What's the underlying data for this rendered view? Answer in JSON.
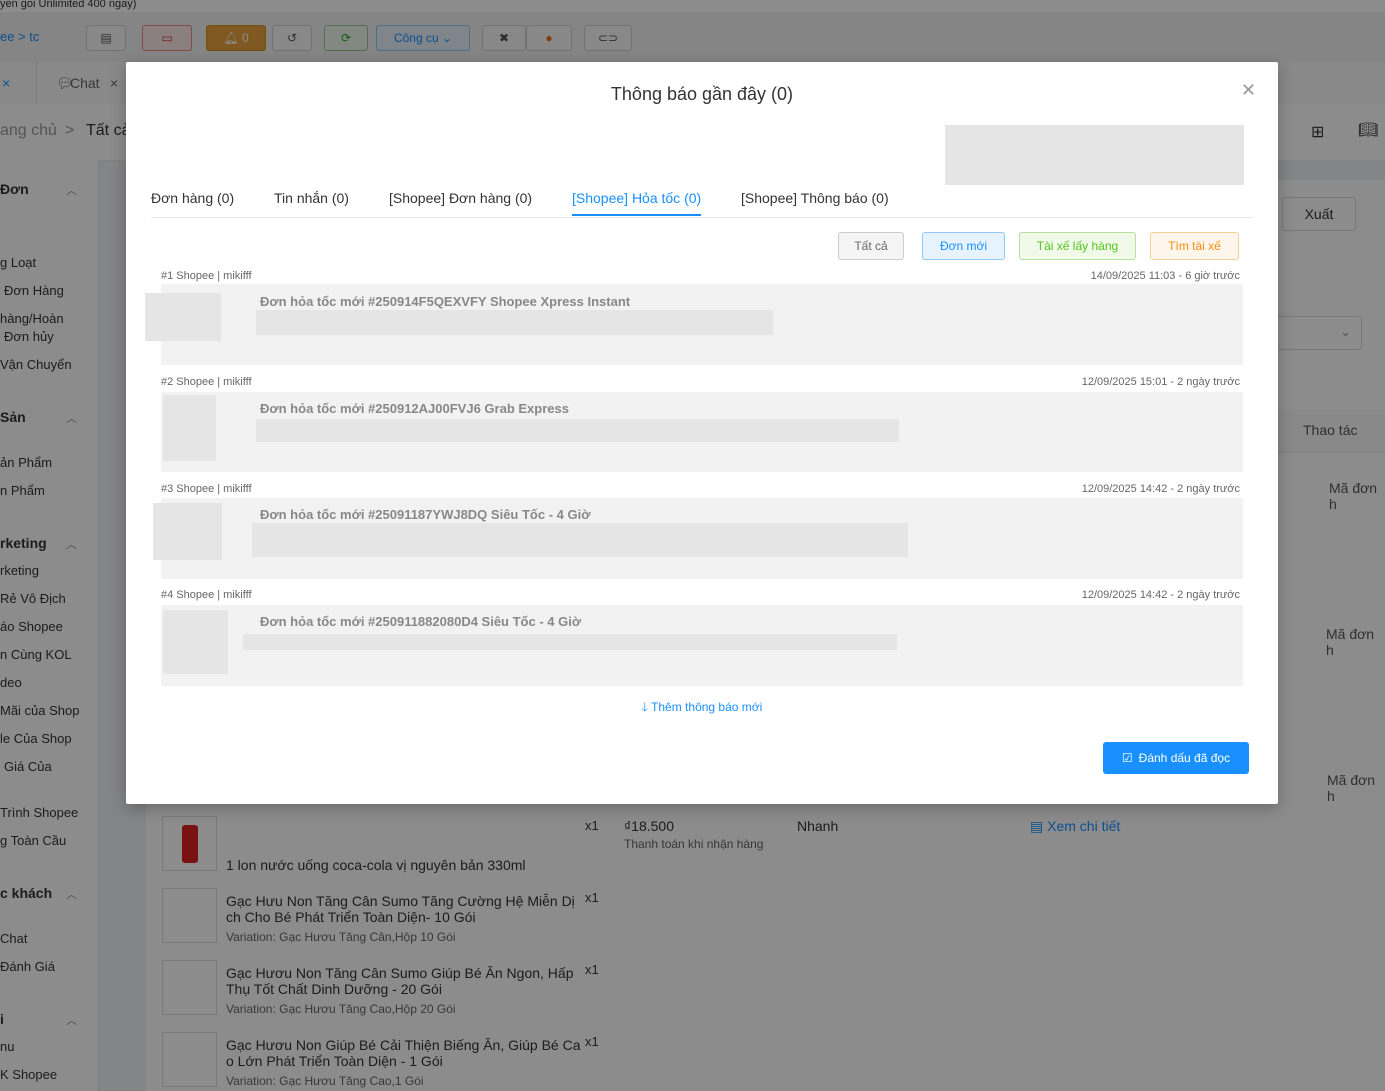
{
  "top": {
    "strip_text": "yen goi Unlimited 400 ngay)",
    "breadcrumb": "ee > tc",
    "tools_label": "Công cụ",
    "bell_count": "0"
  },
  "tabs": [
    {
      "label": "×"
    },
    {
      "label": "Chat"
    },
    {
      "label": "×"
    }
  ],
  "crumb": {
    "home": "ang chủ",
    "sep": ">",
    "current": "Tất cả"
  },
  "sidebar": {
    "sections": [
      {
        "title": "Đơn",
        "items": [
          "g Loạt",
          "Đơn Hàng",
          "hàng/Hoàn",
          "Đơn hủy",
          "Vận Chuyển"
        ]
      },
      {
        "title": "Sản",
        "items": [
          "ản Phẩm",
          "n Phẩm"
        ]
      },
      {
        "title": "rketing",
        "items": [
          "rketing",
          "Rẻ Vô Địch",
          "áo Shopee",
          "n Cùng KOL",
          "deo",
          "Mãi của Shop",
          "le Của Shop",
          "Giá Của",
          "Trình Shopee",
          "g Toàn Cầu"
        ]
      },
      {
        "title": "c khách",
        "items": [
          "Chat",
          "Đánh Giá"
        ]
      },
      {
        "title": "i",
        "items": [
          "nu",
          "K Shopee"
        ]
      }
    ]
  },
  "right": {
    "export": "Xuất",
    "actions_header": "Thao tác",
    "order_code_labels": [
      "Mã đơn h",
      "Mã đơn h",
      "Mã đơn h"
    ]
  },
  "modal": {
    "title": "Thông báo gần đây (0)",
    "tabs": [
      {
        "label": "Đơn hàng (0)",
        "active": false
      },
      {
        "label": "Tin nhắn (0)",
        "active": false
      },
      {
        "label": "[Shopee] Đơn hàng (0)",
        "active": false
      },
      {
        "label": "[Shopee] Hỏa tốc (0)",
        "active": true
      },
      {
        "label": "[Shopee] Thông báo (0)",
        "active": false
      }
    ],
    "filters": {
      "all": "Tất cả",
      "new_order": "Đơn mới",
      "driver_pickup": "Tài xế lấy hàng",
      "find_driver": "Tìm tài xế"
    },
    "notifications": [
      {
        "meta": "#1 Shopee  |  mikifff",
        "time": "14/09/2025 11:03 - 6 giờ trước",
        "title": "Đơn hỏa tốc mới #250914F5QEXVFY Shopee Xpress Instant"
      },
      {
        "meta": "#2 Shopee  |  mikifff",
        "time": "12/09/2025 15:01 - 2 ngày trước",
        "title": "Đơn hỏa tốc mới #250912AJ00FVJ6 Grab Express"
      },
      {
        "meta": "#3 Shopee  |  mikifff",
        "time": "12/09/2025 14:42 - 2 ngày trước",
        "title": "Đơn hỏa tốc mới #25091187YWJ8DQ Siêu Tốc - 4 Giờ"
      },
      {
        "meta": "#4 Shopee  |  mikifff",
        "time": "12/09/2025 14:42 - 2 ngày trước",
        "title": "Đơn hỏa tốc mới #250911882080D4 Siêu Tốc - 4 Giờ"
      }
    ],
    "load_more": "Thêm thông báo mới",
    "mark_read": "Đánh dấu đã đọc"
  },
  "order": {
    "qty1": "x1",
    "price": "₫18.500",
    "payment": "Thanh toán khi nhận hàng",
    "shipping": "Nhanh",
    "detail_link": "Xem chi tiết",
    "items": [
      {
        "name": "1 lon nước uống coca-cola vị nguyên bản 330ml",
        "variation": "",
        "qty": "x1"
      },
      {
        "name": "Gạc Hưu Non Tăng Cân Sumo Tăng Cường Hệ Miễn Dị ch Cho Bé Phát Triển Toàn Diện- 10 Gói",
        "variation": "Variation: Gạc Hươu Tăng Cân,Hộp 10 Gói",
        "qty": "x1"
      },
      {
        "name": "Gạc Hươu Non Tăng Cân Sumo Giúp Bé Ăn Ngon, Hấp Thụ Tốt Chất Dinh Dưỡng - 20 Gói",
        "variation": "Variation: Gạc Hươu Tăng Cao,Hộp 20 Gói",
        "qty": "x1"
      },
      {
        "name": "Gạc Hươu Non Giúp Bé Cải Thiện Biếng Ăn, Giúp Bé Ca o Lớn Phát Triển Toàn Diện - 1 Gói",
        "variation": "Variation: Gạc Hươu Tăng Cao,1 Gói",
        "qty": "x1"
      }
    ]
  }
}
